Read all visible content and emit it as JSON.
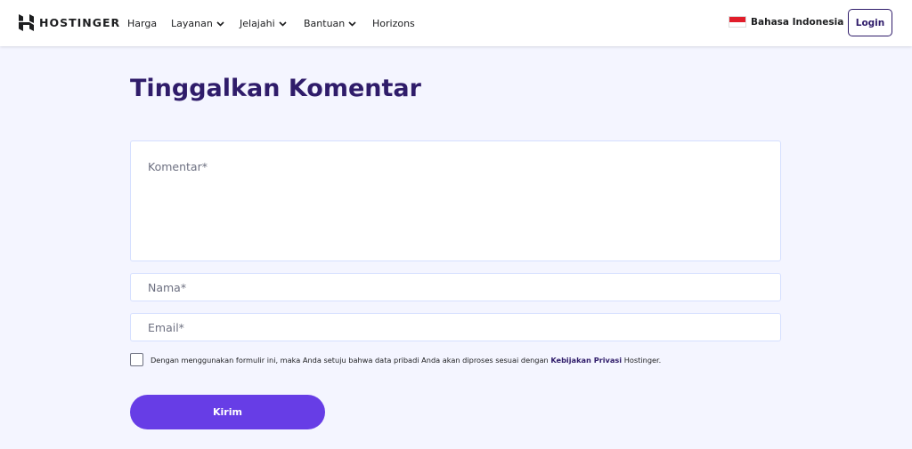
{
  "header": {
    "logo_text": "HOSTINGER",
    "nav": [
      {
        "label": "Harga",
        "has_dropdown": false
      },
      {
        "label": "Layanan",
        "has_dropdown": true
      },
      {
        "label": "Jelajahi",
        "has_dropdown": true
      },
      {
        "label": "Bantuan",
        "has_dropdown": true
      },
      {
        "label": "Horizons",
        "has_dropdown": false
      }
    ],
    "language": "Bahasa Indonesia",
    "login_label": "Login"
  },
  "form": {
    "title": "Tinggalkan Komentar",
    "comment_placeholder": "Komentar*",
    "name_placeholder": "Nama*",
    "email_placeholder": "Email*",
    "consent_prefix": "Dengan menggunakan formulir ini, maka Anda setuju bahwa data pribadi Anda akan diproses sesuai dengan",
    "consent_link": "Kebijakan Privasi",
    "consent_suffix": "Hostinger.",
    "submit_label": "Kirim"
  },
  "colors": {
    "brand_purple": "#673de6",
    "heading_purple": "#2f1c6a",
    "page_background": "#f4f5ff"
  }
}
